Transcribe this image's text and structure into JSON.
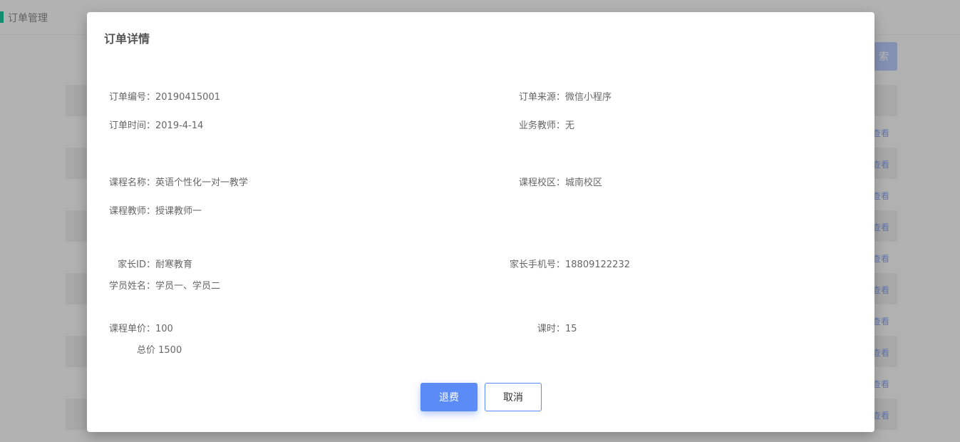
{
  "header": {
    "title": "订单管理",
    "accent_color": "#1cc29b"
  },
  "background": {
    "search_button_label": "索",
    "row_link_label": "查看"
  },
  "dialog": {
    "title": "订单详情",
    "order_no": {
      "label": "订单编号：",
      "value": "20190415001"
    },
    "order_source": {
      "label": "订单来源：",
      "value": "微信小程序"
    },
    "order_time": {
      "label": "订单时间：",
      "value": "2019-4-14"
    },
    "sales_teacher": {
      "label": "业务教师：",
      "value": "无"
    },
    "course_name": {
      "label": "课程名称：",
      "value": "英语个性化一对一教学"
    },
    "course_campus": {
      "label": "课程校区：",
      "value": "城南校区"
    },
    "course_teacher": {
      "label": "课程教师：",
      "value": "授课教师一"
    },
    "parent_id": {
      "label": "家长ID：",
      "value": "耐寒教育"
    },
    "parent_phone": {
      "label": "家长手机号：",
      "value": "18809122232"
    },
    "student_names": {
      "label": "学员姓名：",
      "value": "学员一、学员二"
    },
    "unit_price": {
      "label": "课程单价：",
      "value": "100"
    },
    "lessons": {
      "label": "课时：",
      "value": "15"
    },
    "total_price": {
      "label": "总价",
      "value": "1500"
    },
    "refund_button": "退费",
    "cancel_button": "取消"
  }
}
